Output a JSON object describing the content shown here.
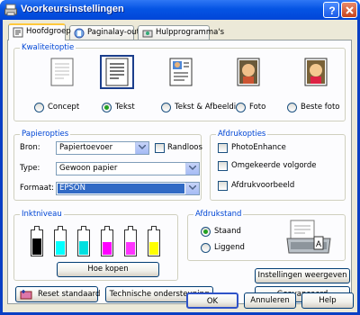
{
  "window": {
    "title": "Voorkeursinstellingen"
  },
  "tabs": [
    {
      "label": "Hoofdgroep",
      "active": true
    },
    {
      "label": "Paginalay-out",
      "active": false
    },
    {
      "label": "Hulpprogramma's",
      "active": false
    }
  ],
  "quality": {
    "label": "Kwaliteitoptie",
    "options": [
      {
        "label": "Concept",
        "selected": false
      },
      {
        "label": "Tekst",
        "selected": true
      },
      {
        "label": "Tekst & Afbeelding",
        "selected": false
      },
      {
        "label": "Foto",
        "selected": false
      },
      {
        "label": "Beste foto",
        "selected": false
      }
    ]
  },
  "paper": {
    "label": "Papieropties",
    "source_label": "Bron:",
    "source_value": "Papiertoevoer",
    "borderless_label": "Randloos",
    "type_label": "Type:",
    "type_value": "Gewoon papier",
    "format_label": "Formaat:",
    "format_value": "EPSON"
  },
  "print_options": {
    "label": "Afdrukopties",
    "photo_enhance": "PhotoEnhance",
    "reverse_order": "Omgekeerde volgorde",
    "preview": "Afdrukvoorbeeld"
  },
  "ink": {
    "label": "Inktniveau",
    "how_to_buy": "Hoe kopen",
    "levels": [
      0.65,
      0.55,
      0.55,
      0.5,
      0.5,
      0.5
    ],
    "colors": [
      "#000000",
      "#00ffff",
      "#00e0e0",
      "#ff00ff",
      "#ff33ff",
      "#ffff00"
    ]
  },
  "orientation": {
    "label": "Afdrukstand",
    "portrait": "Staand",
    "landscape": "Liggend",
    "selected": "portrait"
  },
  "buttons": {
    "reset": "Reset standaard",
    "tech_support": "Technische ondersteuning",
    "show_settings": "Instellingen weergeven",
    "advanced": "Geavanceerd",
    "ok": "OK",
    "cancel": "Annuleren",
    "help": "Help"
  },
  "colors": {
    "title_blue": "#0554e4",
    "group_label": "#0046d5",
    "tab_accent": "#ffc83c",
    "selection": "#316ac5"
  }
}
